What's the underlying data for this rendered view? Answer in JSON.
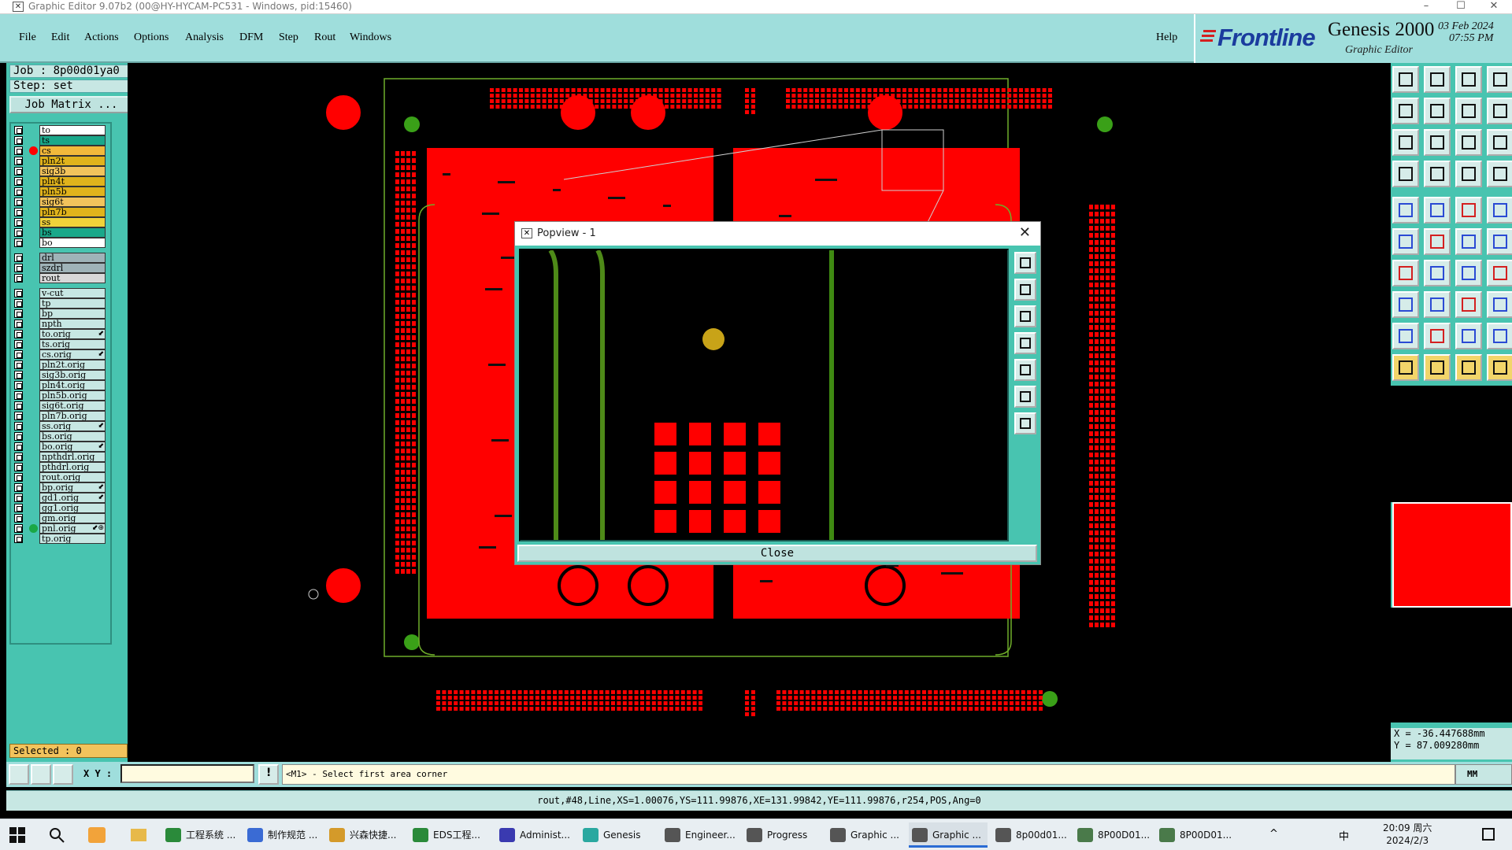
{
  "window": {
    "title": "Graphic Editor 9.07b2 (00@HY-HYCAM-PC531 - Windows, pid:15460)",
    "minimize": "–",
    "maximize": "☐",
    "close": "✕"
  },
  "menu": {
    "items": [
      "File",
      "Edit",
      "Actions",
      "Options",
      "Analysis",
      "DFM",
      "Step",
      "Rout",
      "Windows"
    ],
    "help": "Help"
  },
  "brand": {
    "logo": "Frontline",
    "product": "Genesis 2000",
    "subtitle": "Graphic Editor",
    "date": "03 Feb 2024",
    "time": "07:55 PM"
  },
  "left": {
    "job": "Job : 8p00d01ya0",
    "step": "Step: set",
    "job_matrix": "Job Matrix ..."
  },
  "layers": [
    {
      "name": "to",
      "color": "#ffffff",
      "dot": ""
    },
    {
      "name": "ts",
      "color": "#1aa88a",
      "dot": ""
    },
    {
      "name": "cs",
      "color": "#f2b93b",
      "dot": "#ff0000"
    },
    {
      "name": "pln2t",
      "color": "#e0b31c",
      "dot": ""
    },
    {
      "name": "sig3b",
      "color": "#f2c35c",
      "dot": ""
    },
    {
      "name": "pln4t",
      "color": "#e0b31c",
      "dot": ""
    },
    {
      "name": "pln5b",
      "color": "#e0b31c",
      "dot": ""
    },
    {
      "name": "sig6t",
      "color": "#f2c35c",
      "dot": ""
    },
    {
      "name": "pln7b",
      "color": "#e0b31c",
      "dot": ""
    },
    {
      "name": "ss",
      "color": "#f0d23a",
      "dot": ""
    },
    {
      "name": "bs",
      "color": "#1aa88a",
      "dot": ""
    },
    {
      "name": "bo",
      "color": "#ffffff",
      "dot": ""
    },
    {
      "name": "drl",
      "color": "#9fb3b8",
      "dot": ""
    },
    {
      "name": "szdrl",
      "color": "#9fb3b8",
      "dot": ""
    },
    {
      "name": "rout",
      "color": "#d8d8d8",
      "dot": ""
    },
    {
      "name": "v-cut",
      "color": "#c7e7e3",
      "dot": ""
    },
    {
      "name": "tp",
      "color": "#c7e7e3",
      "dot": ""
    },
    {
      "name": "bp",
      "color": "#c7e7e3",
      "dot": ""
    },
    {
      "name": "npth",
      "color": "#c7e7e3",
      "dot": ""
    },
    {
      "name": "to.orig",
      "color": "#c7e7e3",
      "dot": "",
      "arrow": "⬋"
    },
    {
      "name": "ts.orig",
      "color": "#c7e7e3",
      "dot": ""
    },
    {
      "name": "cs.orig",
      "color": "#c7e7e3",
      "dot": "",
      "arrow": "⬋"
    },
    {
      "name": "pln2t.orig",
      "color": "#c7e7e3",
      "dot": ""
    },
    {
      "name": "sig3b.orig",
      "color": "#c7e7e3",
      "dot": ""
    },
    {
      "name": "pln4t.orig",
      "color": "#c7e7e3",
      "dot": ""
    },
    {
      "name": "pln5b.orig",
      "color": "#c7e7e3",
      "dot": ""
    },
    {
      "name": "sig6t.orig",
      "color": "#c7e7e3",
      "dot": ""
    },
    {
      "name": "pln7b.orig",
      "color": "#c7e7e3",
      "dot": ""
    },
    {
      "name": "ss.orig",
      "color": "#c7e7e3",
      "dot": "",
      "arrow": "⬋"
    },
    {
      "name": "bs.orig",
      "color": "#c7e7e3",
      "dot": ""
    },
    {
      "name": "bo.orig",
      "color": "#c7e7e3",
      "dot": "",
      "arrow": "⬋"
    },
    {
      "name": "npthdrl.orig",
      "color": "#c7e7e3",
      "dot": ""
    },
    {
      "name": "pthdrl.orig",
      "color": "#c7e7e3",
      "dot": ""
    },
    {
      "name": "rout.orig",
      "color": "#c7e7e3",
      "dot": ""
    },
    {
      "name": "bp.orig",
      "color": "#c7e7e3",
      "dot": "",
      "arrow": "⬋"
    },
    {
      "name": "gd1.orig",
      "color": "#c7e7e3",
      "dot": "",
      "arrow": "⬋"
    },
    {
      "name": "gg1.orig",
      "color": "#c7e7e3",
      "dot": ""
    },
    {
      "name": "gm.orig",
      "color": "#c7e7e3",
      "dot": ""
    },
    {
      "name": "pnl.orig",
      "color": "#c7e7e3",
      "dot": "#1aa845",
      "arrow": "⬋⊕"
    },
    {
      "name": "tp.orig",
      "color": "#c7e7e3",
      "dot": ""
    }
  ],
  "selected": "Selected : 0",
  "popview": {
    "title": "Popview - 1",
    "close_x": "✕",
    "close_button": "Close"
  },
  "coords": {
    "x": "X = -36.447688mm",
    "y": "Y =  87.009280mm"
  },
  "bottom": {
    "xy_label": "X Y :",
    "xy_value": "",
    "prompt": "<M1> - Select first area corner",
    "units": "MM"
  },
  "status": "rout,#48,Line,XS=1.00076,YS=111.99876,XE=131.99842,YE=111.99876,r254,POS,Ang=0",
  "taskbar": {
    "items": [
      {
        "label": "工程系统 ...",
        "color": "#2a8a3a"
      },
      {
        "label": "制作规范 ...",
        "color": "#3a6bd4"
      },
      {
        "label": "兴森快捷...",
        "color": "#d49a2a"
      },
      {
        "label": "EDS工程...",
        "color": "#2a8a3a"
      },
      {
        "label": "Administ...",
        "color": "#3a3ab0"
      },
      {
        "label": "Genesis",
        "color": "#2aa8a0"
      },
      {
        "label": "Engineer...",
        "color": "#555555"
      },
      {
        "label": "Progress",
        "color": "#555555"
      },
      {
        "label": "Graphic ...",
        "color": "#555555"
      },
      {
        "label": "Graphic ...",
        "color": "#555555",
        "active": true
      },
      {
        "label": "8p00d01...",
        "color": "#555555"
      },
      {
        "label": "8P00D01...",
        "color": "#4a7a4a"
      },
      {
        "label": "8P00D01...",
        "color": "#4a7a4a"
      }
    ],
    "ime": "中",
    "time": "20:09 周六",
    "date": "2024/2/3"
  }
}
